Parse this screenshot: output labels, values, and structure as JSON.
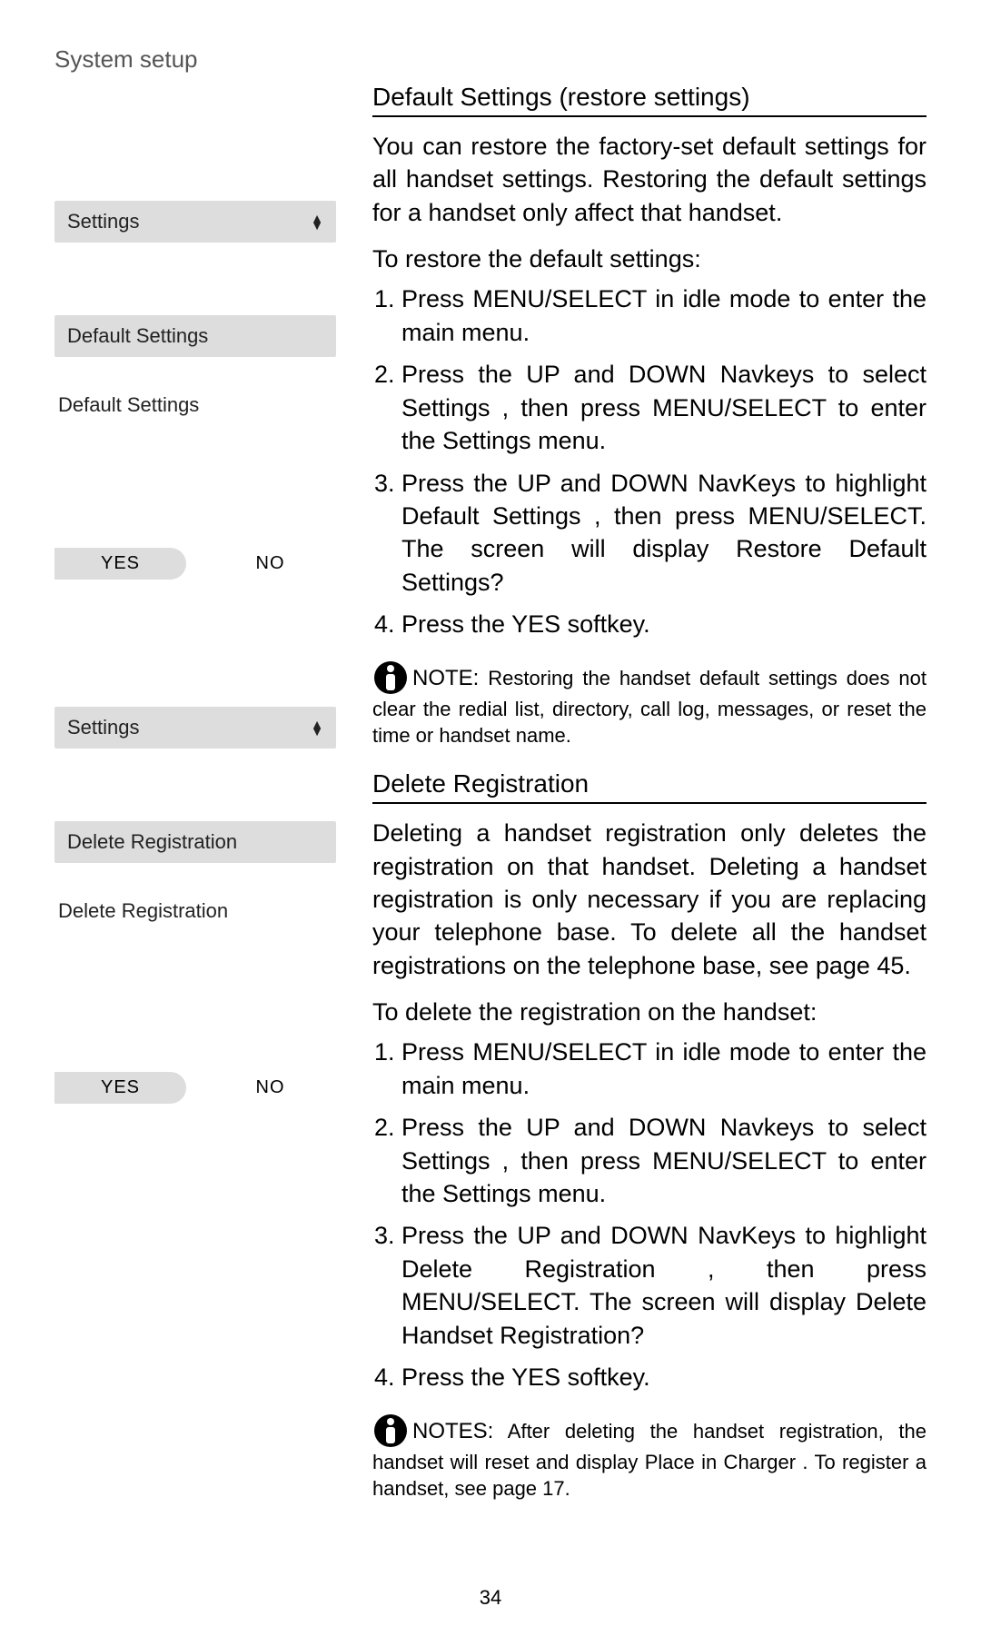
{
  "header": "System setup",
  "page_number": "34",
  "left": {
    "group1": {
      "row1": "Settings",
      "row2": "Default Settings",
      "row3": "Default Settings",
      "soft_left": "YES",
      "soft_right": "NO"
    },
    "group2": {
      "row1": "Settings",
      "row2": "Delete Registration",
      "row3": "Delete Registration",
      "soft_left": "YES",
      "soft_right": "NO"
    }
  },
  "right": {
    "sec1": {
      "title": "Default Settings (restore settings)",
      "para": "You can restore the factory-set default settings for all handset settings. Restoring the default settings for a handset only affect that handset.",
      "lead": "To restore the default settings:",
      "steps": [
        "Press MENU/SELECT in idle mode to enter the main menu.",
        "Press the UP and DOWN Navkeys to select Settings , then press MENU/SELECT to enter the Settings menu.",
        "Press the UP and DOWN NavKeys to highlight Default Settings , then press MENU/SELECT. The screen will display Restore Default Settings?",
        "Press the YES softkey."
      ],
      "note_label": "NOTE:",
      "note_body": " Restoring the handset default settings does not clear the redial list, directory, call log, messages, or reset the time or handset name."
    },
    "sec2": {
      "title": "Delete Registration",
      "para": "Deleting a handset registration only deletes the registration on that handset. Deleting a handset registration is only necessary if you are replacing your telephone base. To delete all the handset registrations on the telephone base, see page 45.",
      "lead": "To delete the registration on the handset:",
      "steps": [
        "Press MENU/SELECT in idle mode to enter the main menu.",
        "Press the UP and DOWN Navkeys to select Settings , then press MENU/SELECT to enter the Settings menu.",
        "Press the UP and DOWN NavKeys to highlight Delete Registration , then press MENU/SELECT. The screen will display Delete Handset Registration?",
        "Press the YES softkey."
      ],
      "note_label": "NOTES:",
      "note_body": " After deleting the handset registration, the handset will reset and display Place in Charger . To register a handset, see page 17."
    }
  }
}
